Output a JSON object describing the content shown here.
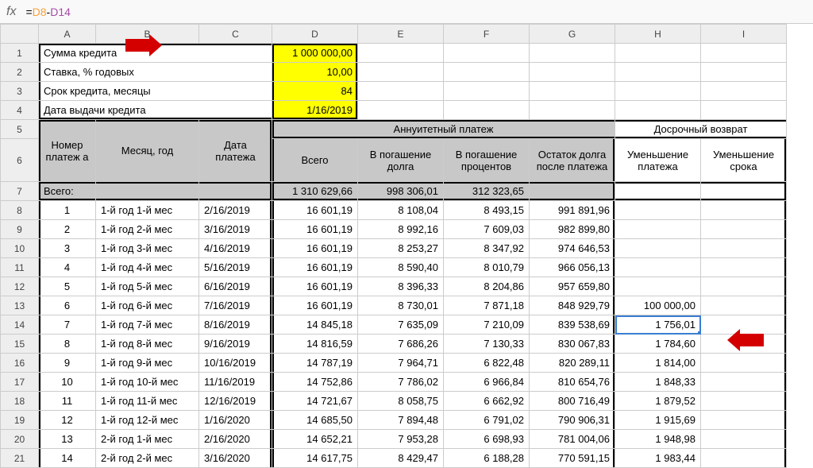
{
  "formula": {
    "eq": "=",
    "ref1": "D8",
    "op": "-",
    "ref2": "D14"
  },
  "cols": [
    "A",
    "B",
    "C",
    "D",
    "E",
    "F",
    "G",
    "H",
    "I"
  ],
  "labels": {
    "r1c1": "Сумма кредита",
    "r1c4": "1 000 000,00",
    "r2c1": "Ставка, % годовых",
    "r2c4": "10,00",
    "r3c1": "Срок кредита, месяцы",
    "r3c4": "84",
    "r4c1": "Дата выдачи кредита",
    "r4c4": "1/16/2019",
    "r5headAnn": "Аннуитетный платеж",
    "r5headRet": "Досрочный возврат",
    "r6c1": "Номер платеж а",
    "r6c2": "Месяц, год",
    "r6c3": "Дата платежа",
    "r6c4": "Всего",
    "r6c5": "В погашение долга",
    "r6c6": "В погашение процентов",
    "r6c7": "Остаток долга после платежа",
    "r6c8": "Уменьшение платежа",
    "r6c9": "Уменьшение срока",
    "r7c1": "Всего:",
    "r7c4": "1 310 629,66",
    "r7c5": "998 306,01",
    "r7c6": "312 323,65"
  },
  "rows": [
    {
      "n": "8",
      "a": "1",
      "b": "1-й год 1-й мес",
      "c": "2/16/2019",
      "d": "16 601,19",
      "e": "8 108,04",
      "f": "8 493,15",
      "g": "991 891,96",
      "h": "",
      "i": ""
    },
    {
      "n": "9",
      "a": "2",
      "b": "1-й год 2-й мес",
      "c": "3/16/2019",
      "d": "16 601,19",
      "e": "8 992,16",
      "f": "7 609,03",
      "g": "982 899,80",
      "h": "",
      "i": ""
    },
    {
      "n": "10",
      "a": "3",
      "b": "1-й год 3-й мес",
      "c": "4/16/2019",
      "d": "16 601,19",
      "e": "8 253,27",
      "f": "8 347,92",
      "g": "974 646,53",
      "h": "",
      "i": ""
    },
    {
      "n": "11",
      "a": "4",
      "b": "1-й год 4-й мес",
      "c": "5/16/2019",
      "d": "16 601,19",
      "e": "8 590,40",
      "f": "8 010,79",
      "g": "966 056,13",
      "h": "",
      "i": ""
    },
    {
      "n": "12",
      "a": "5",
      "b": "1-й год 5-й мес",
      "c": "6/16/2019",
      "d": "16 601,19",
      "e": "8 396,33",
      "f": "8 204,86",
      "g": "957 659,80",
      "h": "",
      "i": ""
    },
    {
      "n": "13",
      "a": "6",
      "b": "1-й год 6-й мес",
      "c": "7/16/2019",
      "d": "16 601,19",
      "e": "8 730,01",
      "f": "7 871,18",
      "g": "848 929,79",
      "h": "100 000,00",
      "i": ""
    },
    {
      "n": "14",
      "a": "7",
      "b": "1-й год 7-й мес",
      "c": "8/16/2019",
      "d": "14 845,18",
      "e": "7 635,09",
      "f": "7 210,09",
      "g": "839 538,69",
      "h": "1 756,01",
      "i": ""
    },
    {
      "n": "15",
      "a": "8",
      "b": "1-й год 8-й мес",
      "c": "9/16/2019",
      "d": "14 816,59",
      "e": "7 686,26",
      "f": "7 130,33",
      "g": "830 067,83",
      "h": "1 784,60",
      "i": ""
    },
    {
      "n": "16",
      "a": "9",
      "b": "1-й год 9-й мес",
      "c": "10/16/2019",
      "d": "14 787,19",
      "e": "7 964,71",
      "f": "6 822,48",
      "g": "820 289,11",
      "h": "1 814,00",
      "i": ""
    },
    {
      "n": "17",
      "a": "10",
      "b": "1-й год 10-й мес",
      "c": "11/16/2019",
      "d": "14 752,86",
      "e": "7 786,02",
      "f": "6 966,84",
      "g": "810 654,76",
      "h": "1 848,33",
      "i": ""
    },
    {
      "n": "18",
      "a": "11",
      "b": "1-й год 11-й мес",
      "c": "12/16/2019",
      "d": "14 721,67",
      "e": "8 058,75",
      "f": "6 662,92",
      "g": "800 716,49",
      "h": "1 879,52",
      "i": ""
    },
    {
      "n": "19",
      "a": "12",
      "b": "1-й год 12-й мес",
      "c": "1/16/2020",
      "d": "14 685,50",
      "e": "7 894,48",
      "f": "6 791,02",
      "g": "790 906,31",
      "h": "1 915,69",
      "i": ""
    },
    {
      "n": "20",
      "a": "13",
      "b": "2-й год 1-й мес",
      "c": "2/16/2020",
      "d": "14 652,21",
      "e": "7 953,28",
      "f": "6 698,93",
      "g": "781 004,06",
      "h": "1 948,98",
      "i": ""
    },
    {
      "n": "21",
      "a": "14",
      "b": "2-й год 2-й мес",
      "c": "3/16/2020",
      "d": "14 617,75",
      "e": "8 429,47",
      "f": "6 188,28",
      "g": "770 591,15",
      "h": "1 983,44",
      "i": ""
    }
  ]
}
